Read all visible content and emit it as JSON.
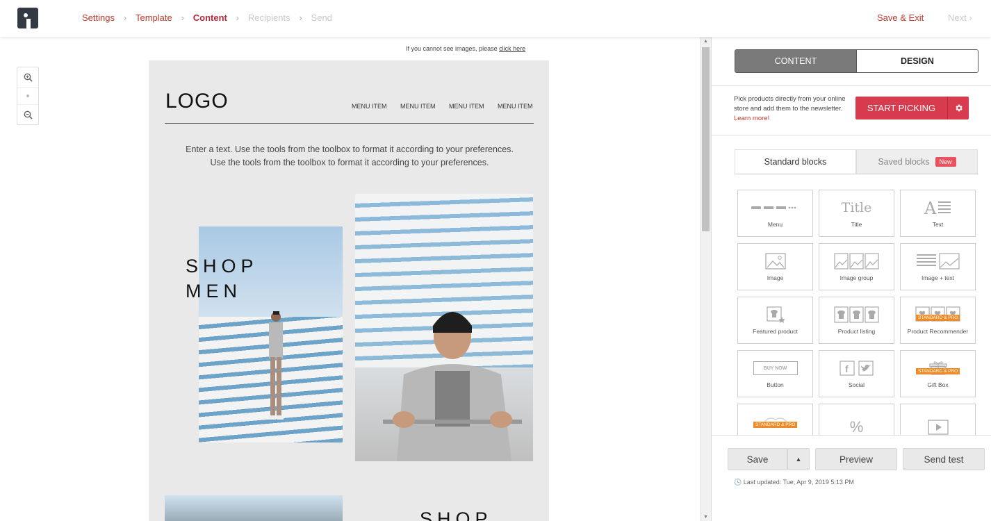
{
  "header": {
    "steps": [
      {
        "label": "Settings",
        "state": "done"
      },
      {
        "label": "Template",
        "state": "done"
      },
      {
        "label": "Content",
        "state": "active"
      },
      {
        "label": "Recipients",
        "state": "disabled"
      },
      {
        "label": "Send",
        "state": "disabled"
      }
    ],
    "save_exit": "Save & Exit",
    "next": "Next"
  },
  "editor": {
    "cannot_see_text": "If you cannot see images, please",
    "click_here": "click here",
    "email": {
      "logo": "LOGO",
      "menu": [
        "MENU ITEM",
        "MENU ITEM",
        "MENU ITEM",
        "MENU ITEM"
      ],
      "text_line1": "Enter a text. Use the tools from the toolbox to format it according to your preferences.",
      "text_line2": "Use the tools from the toolbox to format it according to your preferences.",
      "shop1": "SHOP",
      "shop2": "MEN",
      "shop_bottom": "SHOP"
    }
  },
  "panel": {
    "content_tab": "CONTENT",
    "design_tab": "DESIGN",
    "pick_text": "Pick products directly from your online store and add them to the newsletter.",
    "learn_more": "Learn more!",
    "start_picking": "START PICKING",
    "standard_blocks": "Standard blocks",
    "saved_blocks": "Saved blocks",
    "new_badge": "New",
    "blocks": [
      {
        "label": "Menu",
        "icon": "menu-icon"
      },
      {
        "label": "Title",
        "icon": "title-icon"
      },
      {
        "label": "Text",
        "icon": "text-icon"
      },
      {
        "label": "Image",
        "icon": "image-icon"
      },
      {
        "label": "Image group",
        "icon": "image-group-icon"
      },
      {
        "label": "Image + text",
        "icon": "image-text-icon"
      },
      {
        "label": "Featured product",
        "icon": "featured-product-icon"
      },
      {
        "label": "Product listing",
        "icon": "product-listing-icon"
      },
      {
        "label": "Product Recommender",
        "icon": "product-recommender-icon",
        "tag": "STANDARD & PRO"
      },
      {
        "label": "Button",
        "icon": "button-icon",
        "inner": "BUY NOW"
      },
      {
        "label": "Social",
        "icon": "social-icon"
      },
      {
        "label": "Gift Box",
        "icon": "gift-box-icon",
        "tag": "STANDARD & PRO"
      },
      {
        "label": "",
        "icon": "coupon-icon",
        "tag": "STANDARD & PRO"
      },
      {
        "label": "",
        "icon": "percent-icon"
      },
      {
        "label": "",
        "icon": "video-icon"
      }
    ],
    "save": "Save",
    "preview": "Preview",
    "send_test": "Send test",
    "last_updated_label": "Last updated:",
    "last_updated_value": "Tue, Apr 9, 2019 5:13 PM"
  },
  "colors": {
    "accent": "#d83a4e",
    "step_active": "#b3283d",
    "tag_orange": "#f08a24"
  }
}
